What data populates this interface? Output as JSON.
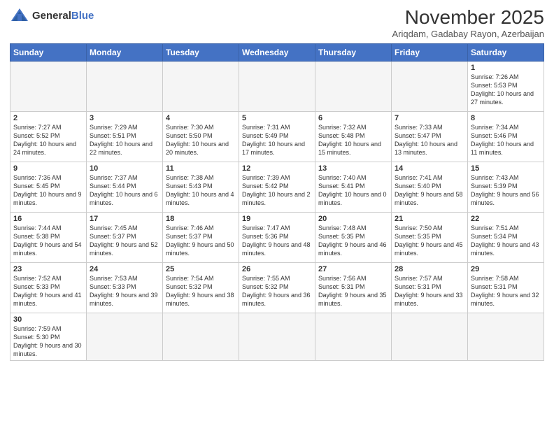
{
  "logo": {
    "general": "General",
    "blue": "Blue"
  },
  "title": "November 2025",
  "subtitle": "Ariqdam, Gadabay Rayon, Azerbaijan",
  "weekdays": [
    "Sunday",
    "Monday",
    "Tuesday",
    "Wednesday",
    "Thursday",
    "Friday",
    "Saturday"
  ],
  "weeks": [
    [
      {
        "day": "",
        "info": ""
      },
      {
        "day": "",
        "info": ""
      },
      {
        "day": "",
        "info": ""
      },
      {
        "day": "",
        "info": ""
      },
      {
        "day": "",
        "info": ""
      },
      {
        "day": "",
        "info": ""
      },
      {
        "day": "1",
        "info": "Sunrise: 7:26 AM\nSunset: 5:53 PM\nDaylight: 10 hours\nand 27 minutes."
      }
    ],
    [
      {
        "day": "2",
        "info": "Sunrise: 7:27 AM\nSunset: 5:52 PM\nDaylight: 10 hours\nand 24 minutes."
      },
      {
        "day": "3",
        "info": "Sunrise: 7:29 AM\nSunset: 5:51 PM\nDaylight: 10 hours\nand 22 minutes."
      },
      {
        "day": "4",
        "info": "Sunrise: 7:30 AM\nSunset: 5:50 PM\nDaylight: 10 hours\nand 20 minutes."
      },
      {
        "day": "5",
        "info": "Sunrise: 7:31 AM\nSunset: 5:49 PM\nDaylight: 10 hours\nand 17 minutes."
      },
      {
        "day": "6",
        "info": "Sunrise: 7:32 AM\nSunset: 5:48 PM\nDaylight: 10 hours\nand 15 minutes."
      },
      {
        "day": "7",
        "info": "Sunrise: 7:33 AM\nSunset: 5:47 PM\nDaylight: 10 hours\nand 13 minutes."
      },
      {
        "day": "8",
        "info": "Sunrise: 7:34 AM\nSunset: 5:46 PM\nDaylight: 10 hours\nand 11 minutes."
      }
    ],
    [
      {
        "day": "9",
        "info": "Sunrise: 7:36 AM\nSunset: 5:45 PM\nDaylight: 10 hours\nand 9 minutes."
      },
      {
        "day": "10",
        "info": "Sunrise: 7:37 AM\nSunset: 5:44 PM\nDaylight: 10 hours\nand 6 minutes."
      },
      {
        "day": "11",
        "info": "Sunrise: 7:38 AM\nSunset: 5:43 PM\nDaylight: 10 hours\nand 4 minutes."
      },
      {
        "day": "12",
        "info": "Sunrise: 7:39 AM\nSunset: 5:42 PM\nDaylight: 10 hours\nand 2 minutes."
      },
      {
        "day": "13",
        "info": "Sunrise: 7:40 AM\nSunset: 5:41 PM\nDaylight: 10 hours\nand 0 minutes."
      },
      {
        "day": "14",
        "info": "Sunrise: 7:41 AM\nSunset: 5:40 PM\nDaylight: 9 hours\nand 58 minutes."
      },
      {
        "day": "15",
        "info": "Sunrise: 7:43 AM\nSunset: 5:39 PM\nDaylight: 9 hours\nand 56 minutes."
      }
    ],
    [
      {
        "day": "16",
        "info": "Sunrise: 7:44 AM\nSunset: 5:38 PM\nDaylight: 9 hours\nand 54 minutes."
      },
      {
        "day": "17",
        "info": "Sunrise: 7:45 AM\nSunset: 5:37 PM\nDaylight: 9 hours\nand 52 minutes."
      },
      {
        "day": "18",
        "info": "Sunrise: 7:46 AM\nSunset: 5:37 PM\nDaylight: 9 hours\nand 50 minutes."
      },
      {
        "day": "19",
        "info": "Sunrise: 7:47 AM\nSunset: 5:36 PM\nDaylight: 9 hours\nand 48 minutes."
      },
      {
        "day": "20",
        "info": "Sunrise: 7:48 AM\nSunset: 5:35 PM\nDaylight: 9 hours\nand 46 minutes."
      },
      {
        "day": "21",
        "info": "Sunrise: 7:50 AM\nSunset: 5:35 PM\nDaylight: 9 hours\nand 45 minutes."
      },
      {
        "day": "22",
        "info": "Sunrise: 7:51 AM\nSunset: 5:34 PM\nDaylight: 9 hours\nand 43 minutes."
      }
    ],
    [
      {
        "day": "23",
        "info": "Sunrise: 7:52 AM\nSunset: 5:33 PM\nDaylight: 9 hours\nand 41 minutes."
      },
      {
        "day": "24",
        "info": "Sunrise: 7:53 AM\nSunset: 5:33 PM\nDaylight: 9 hours\nand 39 minutes."
      },
      {
        "day": "25",
        "info": "Sunrise: 7:54 AM\nSunset: 5:32 PM\nDaylight: 9 hours\nand 38 minutes."
      },
      {
        "day": "26",
        "info": "Sunrise: 7:55 AM\nSunset: 5:32 PM\nDaylight: 9 hours\nand 36 minutes."
      },
      {
        "day": "27",
        "info": "Sunrise: 7:56 AM\nSunset: 5:31 PM\nDaylight: 9 hours\nand 35 minutes."
      },
      {
        "day": "28",
        "info": "Sunrise: 7:57 AM\nSunset: 5:31 PM\nDaylight: 9 hours\nand 33 minutes."
      },
      {
        "day": "29",
        "info": "Sunrise: 7:58 AM\nSunset: 5:31 PM\nDaylight: 9 hours\nand 32 minutes."
      }
    ],
    [
      {
        "day": "30",
        "info": "Sunrise: 7:59 AM\nSunset: 5:30 PM\nDaylight: 9 hours\nand 30 minutes."
      },
      {
        "day": "",
        "info": ""
      },
      {
        "day": "",
        "info": ""
      },
      {
        "day": "",
        "info": ""
      },
      {
        "day": "",
        "info": ""
      },
      {
        "day": "",
        "info": ""
      },
      {
        "day": "",
        "info": ""
      }
    ]
  ]
}
